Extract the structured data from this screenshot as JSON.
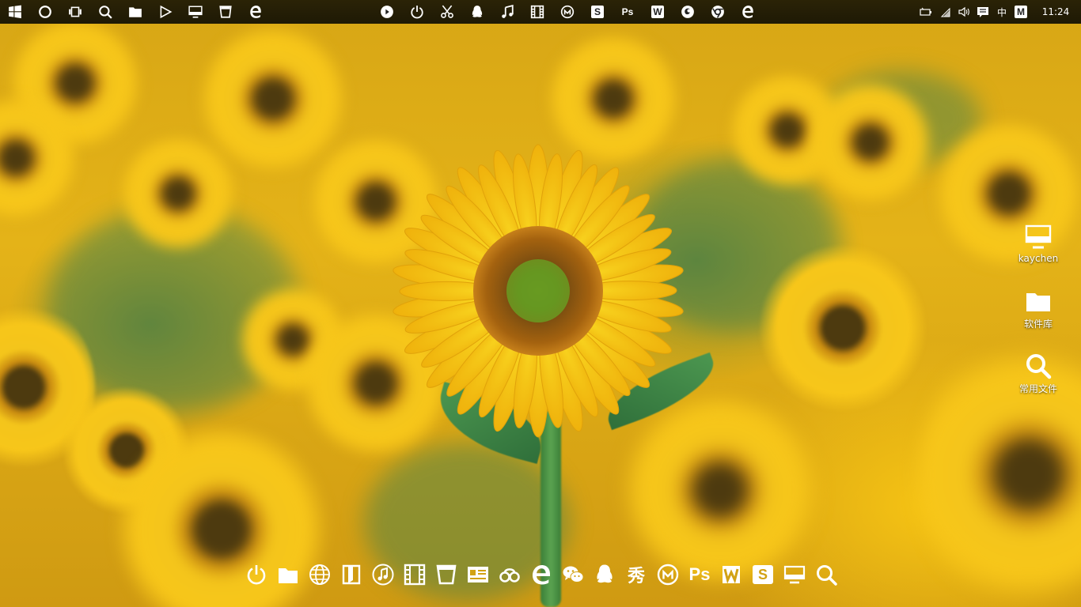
{
  "taskbar": {
    "left_icons": [
      "windows-start-icon",
      "cortana-circle-icon",
      "task-view-icon",
      "search-icon",
      "folder-icon",
      "play-triangle-icon",
      "monitor-icon",
      "store-bag-icon",
      "edge-icon"
    ],
    "center_icons": [
      "media-player-icon",
      "power-icon",
      "scissors-icon",
      "qq-penguin-icon",
      "music-note-icon",
      "film-icon",
      "maxthon-icon",
      "sogou-s-icon",
      "photoshop-icon",
      "wps-w-icon",
      "firefox-icon",
      "chrome-icon",
      "edge-icon-2"
    ],
    "center_text": {
      "photoshop": "Ps",
      "sogou": "S",
      "wps": "W"
    },
    "tray": {
      "ime_label": "中",
      "ime_mode": "M",
      "time": "11:24"
    }
  },
  "desktop": {
    "icons": [
      {
        "label": "kaychen",
        "icon": "computer-monitor-icon"
      },
      {
        "label": "软件库",
        "icon": "folder-icon"
      },
      {
        "label": "常用文件",
        "icon": "search-icon"
      }
    ]
  },
  "dock": {
    "items": [
      "power-icon",
      "folder-icon",
      "globe-icon",
      "book-icon",
      "music-note-icon",
      "film-icon",
      "store-bag-icon",
      "id-card-icon",
      "cloud-link-icon",
      "edge-icon",
      "wechat-icon",
      "qq-penguin-icon",
      "meitu-xiu-icon",
      "maxthon-icon",
      "photoshop-icon",
      "wps-w-icon",
      "sogou-s-icon",
      "monitor-icon",
      "search-icon"
    ],
    "text": {
      "xiu": "秀",
      "ps": "Ps",
      "s": "S"
    }
  },
  "colors": {
    "taskbar_bg": "#221c05",
    "wallpaper_yellow": "#e4b318",
    "leaf_green": "#3f8a48"
  }
}
